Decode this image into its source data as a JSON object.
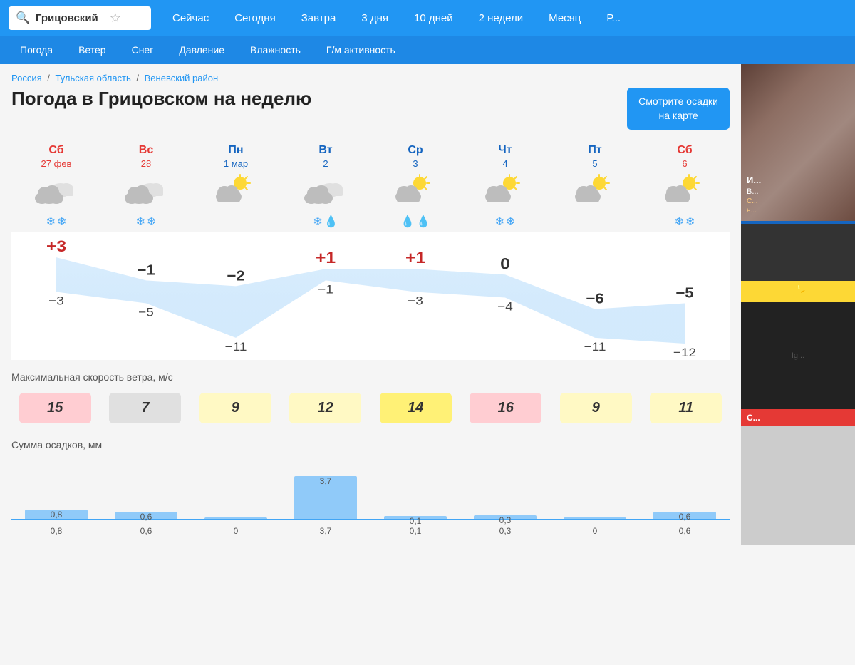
{
  "search": {
    "placeholder": "Грицовский",
    "star": "☆"
  },
  "nav": {
    "tabs": [
      "Сейчас",
      "Сегодня",
      "Завтра",
      "3 дня",
      "10 дней",
      "2 недели",
      "Месяц",
      "Р..."
    ]
  },
  "subnav": {
    "tabs": [
      "Погода",
      "Ветер",
      "Снег",
      "Давление",
      "Влажность",
      "Г/м активность"
    ]
  },
  "breadcrumb": {
    "items": [
      "Россия",
      "Тульская область",
      "Веневский район"
    ]
  },
  "page": {
    "title": "Погода в Грицовском на неделю",
    "map_button": "Смотрите осадки\nна карте"
  },
  "days": [
    {
      "name": "Сб",
      "date": "27 фев",
      "weekend": true,
      "icon": "overcast_snow",
      "precip_sym": [
        "❄",
        "❄"
      ]
    },
    {
      "name": "Вс",
      "date": "28",
      "weekend": true,
      "icon": "overcast_snow",
      "precip_sym": [
        "❄",
        "❄"
      ]
    },
    {
      "name": "Пн",
      "date": "1 мар",
      "weekend": false,
      "icon": "partly_cloudy",
      "precip_sym": []
    },
    {
      "name": "Вт",
      "date": "2",
      "weekend": false,
      "icon": "overcast_rain_snow",
      "precip_sym": [
        "❄",
        "💧"
      ]
    },
    {
      "name": "Ср",
      "date": "3",
      "weekend": false,
      "icon": "partly_cloudy_rain",
      "precip_sym": [
        "💧",
        "💧"
      ]
    },
    {
      "name": "Чт",
      "date": "4",
      "weekend": false,
      "icon": "partly_cloudy",
      "precip_sym": [
        "❄",
        "❄"
      ]
    },
    {
      "name": "Пт",
      "date": "5",
      "weekend": false,
      "icon": "partly_cloudy",
      "precip_sym": []
    },
    {
      "name": "Сб",
      "date": "6",
      "weekend": true,
      "icon": "partly_cloudy",
      "precip_sym": [
        "❄",
        "❄"
      ]
    }
  ],
  "temperatures": {
    "high": [
      "+3",
      "−1",
      "−2",
      "+1",
      "+1",
      "0",
      "−6",
      "−5"
    ],
    "low": [
      "−3",
      "−5",
      "−11",
      "−1",
      "−3",
      "−4",
      "−11",
      "−12"
    ]
  },
  "wind": {
    "label": "Максимальная скорость ветра, м/с",
    "values": [
      15,
      7,
      9,
      12,
      14,
      16,
      9,
      11
    ],
    "colors": [
      "#FFCDD2",
      "#e0e0e0",
      "#FFF9C4",
      "#FFF9C4",
      "#FFF176",
      "#FFCDD2",
      "#FFF9C4",
      "#FFF9C4"
    ]
  },
  "precipitation": {
    "label": "Сумма осадков, мм",
    "values": [
      0.8,
      0.6,
      0,
      3.7,
      0.1,
      0.3,
      0,
      0.6
    ],
    "max": 3.7
  }
}
